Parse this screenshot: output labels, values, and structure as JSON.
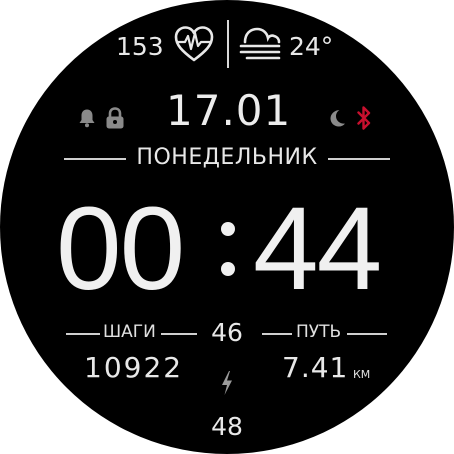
{
  "status_row": {
    "heart_rate": "153",
    "heart_icon": "heart-pulse-icon",
    "weather_icon": "fog-icon",
    "temperature": "24°"
  },
  "date_row": {
    "date": "17.01",
    "left_icons": [
      "bell-icon",
      "lock-icon"
    ],
    "right_icons": [
      "moon-icon",
      "bluetooth-icon"
    ],
    "bluetooth_color": "#c8102e"
  },
  "weekday": "ПОНЕДЕЛЬНИК",
  "time": {
    "hours": "00",
    "minutes": "44"
  },
  "stats": {
    "steps_label": "ШАГИ",
    "steps_value": "10922",
    "center_value": "46",
    "distance_label": "ПУТЬ",
    "distance_value": "7.41",
    "distance_unit": "КМ",
    "battery_icon": "lightning-bolt-icon",
    "battery_value": "48"
  },
  "colors": {
    "face_background": "#000000",
    "text": "#e8e8e8",
    "icon_dim": "#8a8a8a"
  }
}
